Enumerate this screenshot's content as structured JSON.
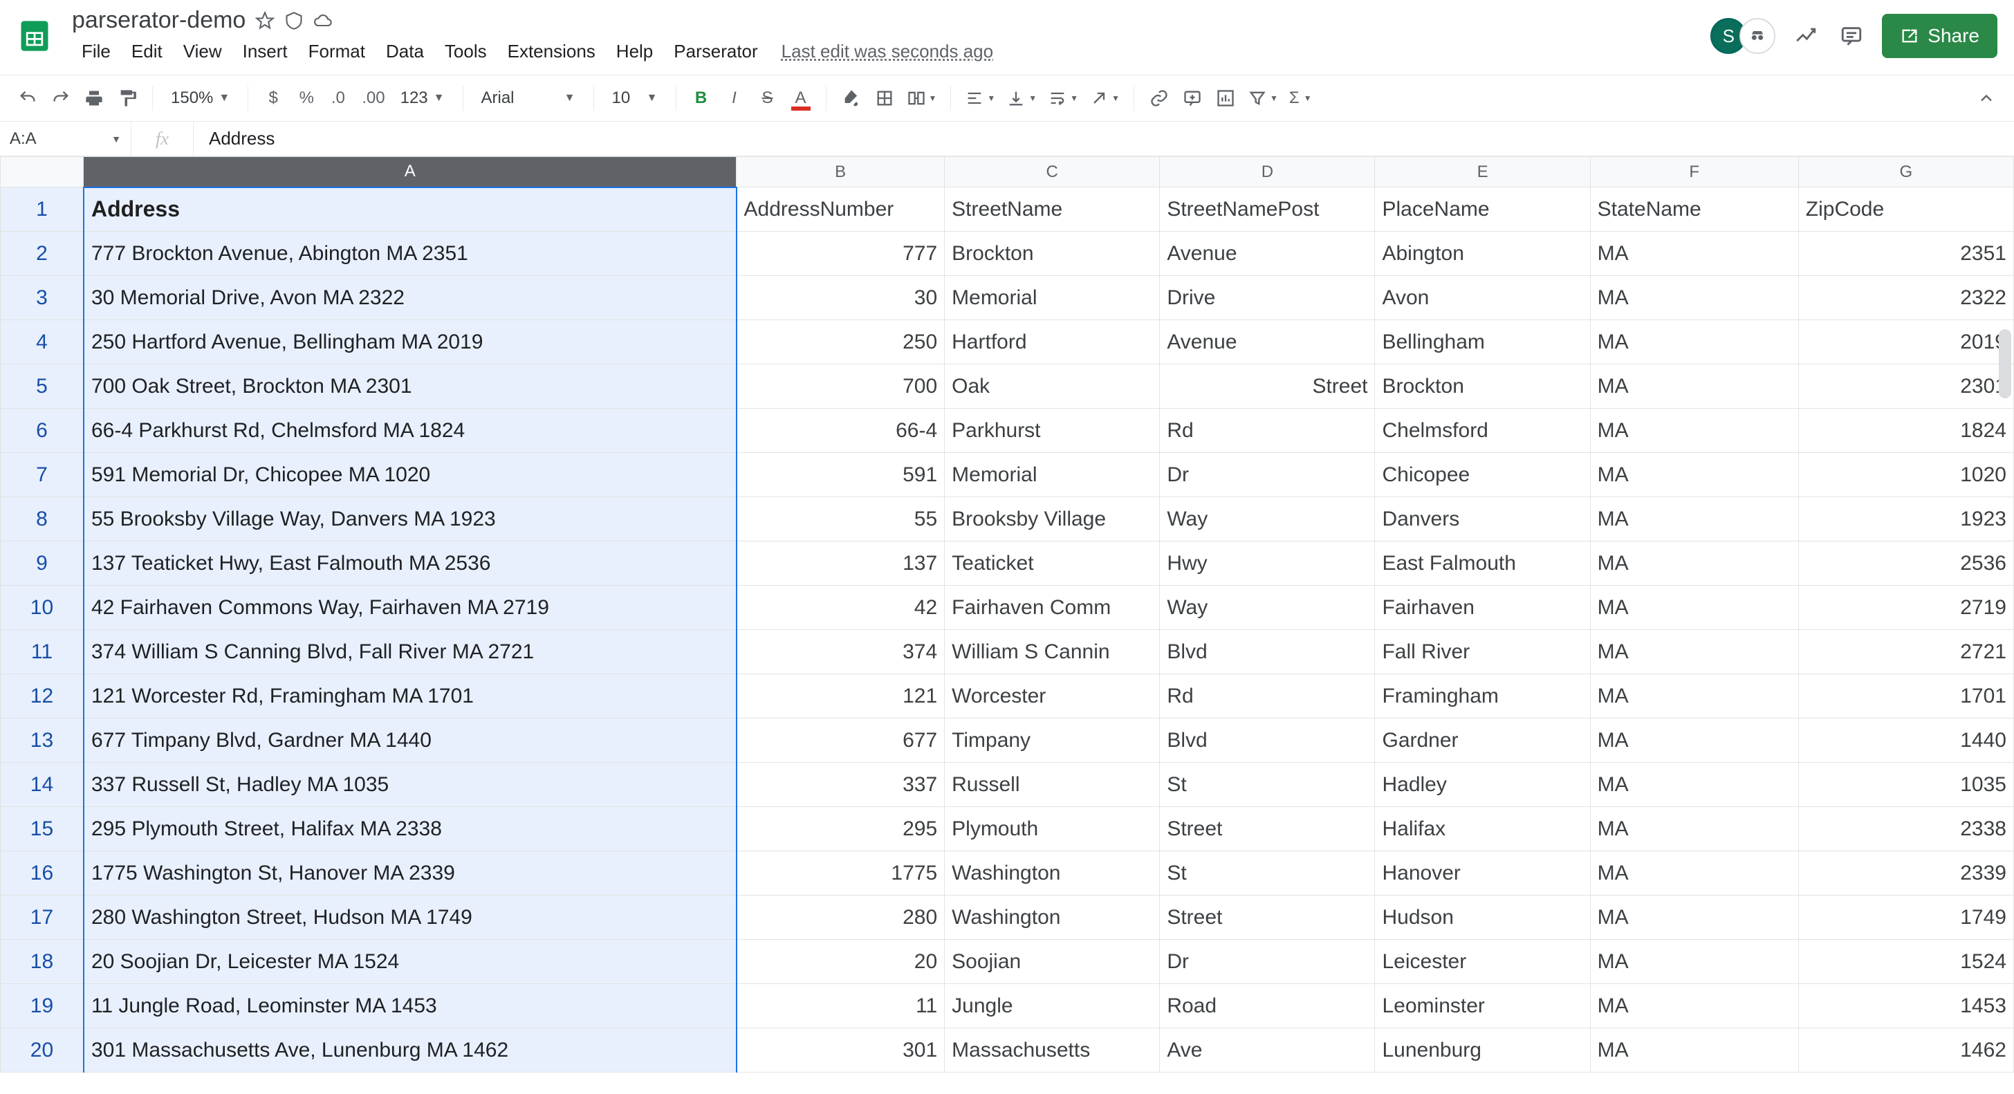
{
  "doc": {
    "title": "parserator-demo",
    "last_edit": "Last edit was seconds ago"
  },
  "menus": [
    "File",
    "Edit",
    "View",
    "Insert",
    "Format",
    "Data",
    "Tools",
    "Extensions",
    "Help",
    "Parserator"
  ],
  "share": "Share",
  "avatar_letter": "S",
  "toolbar": {
    "zoom": "150%",
    "font": "Arial",
    "size": "10",
    "fmt123": "123"
  },
  "namebox": "A:A",
  "fx_value": "Address",
  "columns": [
    "A",
    "B",
    "C",
    "D",
    "E",
    "F",
    "G"
  ],
  "col_widths": [
    "colA",
    "colB",
    "colC",
    "colD",
    "colE",
    "colF",
    "colG"
  ],
  "headers": [
    "Address",
    "AddressNumber",
    "StreetName",
    "StreetNamePost",
    "PlaceName",
    "StateName",
    "ZipCode"
  ],
  "rows": [
    {
      "n": 2,
      "a": "777 Brockton Avenue, Abington MA 2351",
      "b": "777",
      "c": "Brockton",
      "d": "Avenue",
      "e": "Abington",
      "f": "MA",
      "g": "2351"
    },
    {
      "n": 3,
      "a": "30 Memorial Drive, Avon MA 2322",
      "b": "30",
      "c": "Memorial",
      "d": "Drive",
      "e": "Avon",
      "f": "MA",
      "g": "2322"
    },
    {
      "n": 4,
      "a": "250 Hartford Avenue, Bellingham MA 2019",
      "b": "250",
      "c": "Hartford",
      "d": "Avenue",
      "e": "Bellingham",
      "f": "MA",
      "g": "2019"
    },
    {
      "n": 5,
      "a": "700 Oak Street, Brockton MA 2301",
      "b": "700",
      "c": "Oak",
      "d": "",
      "d_right": "Street",
      "e": "Brockton",
      "f": "MA",
      "g": "2301"
    },
    {
      "n": 6,
      "a": "66-4 Parkhurst Rd, Chelmsford MA 1824",
      "b": "66-4",
      "c": "Parkhurst",
      "d": "Rd",
      "e": "Chelmsford",
      "f": "MA",
      "g": "1824"
    },
    {
      "n": 7,
      "a": "591 Memorial Dr, Chicopee MA 1020",
      "b": "591",
      "c": "Memorial",
      "d": "Dr",
      "e": "Chicopee",
      "f": "MA",
      "g": "1020"
    },
    {
      "n": 8,
      "a": "55 Brooksby Village Way, Danvers MA 1923",
      "b": "55",
      "c": "Brooksby Village",
      "d": "Way",
      "e": "Danvers",
      "f": "MA",
      "g": "1923"
    },
    {
      "n": 9,
      "a": "137 Teaticket Hwy, East Falmouth MA 2536",
      "b": "137",
      "c": "Teaticket",
      "d": "Hwy",
      "e": "East Falmouth",
      "f": "MA",
      "g": "2536"
    },
    {
      "n": 10,
      "a": "42 Fairhaven Commons Way, Fairhaven MA 2719",
      "b": "42",
      "c": "Fairhaven Comm",
      "d": "Way",
      "e": "Fairhaven",
      "f": "MA",
      "g": "2719"
    },
    {
      "n": 11,
      "a": "374 William S Canning Blvd, Fall River MA 2721",
      "b": "374",
      "c": "William S Cannin",
      "d": "Blvd",
      "e": "Fall River",
      "f": "MA",
      "g": "2721"
    },
    {
      "n": 12,
      "a": "121 Worcester Rd, Framingham MA 1701",
      "b": "121",
      "c": "Worcester",
      "d": "Rd",
      "e": "Framingham",
      "f": "MA",
      "g": "1701"
    },
    {
      "n": 13,
      "a": "677 Timpany Blvd, Gardner MA 1440",
      "b": "677",
      "c": "Timpany",
      "d": "Blvd",
      "e": "Gardner",
      "f": "MA",
      "g": "1440"
    },
    {
      "n": 14,
      "a": "337 Russell St, Hadley MA 1035",
      "b": "337",
      "c": "Russell",
      "d": "St",
      "e": "Hadley",
      "f": "MA",
      "g": "1035"
    },
    {
      "n": 15,
      "a": "295 Plymouth Street, Halifax MA 2338",
      "b": "295",
      "c": "Plymouth",
      "d": "Street",
      "e": "Halifax",
      "f": "MA",
      "g": "2338"
    },
    {
      "n": 16,
      "a": "1775 Washington St, Hanover MA 2339",
      "b": "1775",
      "c": "Washington",
      "d": "St",
      "e": "Hanover",
      "f": "MA",
      "g": "2339"
    },
    {
      "n": 17,
      "a": "280 Washington Street, Hudson MA 1749",
      "b": "280",
      "c": "Washington",
      "d": "Street",
      "e": "Hudson",
      "f": "MA",
      "g": "1749"
    },
    {
      "n": 18,
      "a": "20 Soojian Dr, Leicester MA 1524",
      "b": "20",
      "c": "Soojian",
      "d": "Dr",
      "e": "Leicester",
      "f": "MA",
      "g": "1524"
    },
    {
      "n": 19,
      "a": "11 Jungle Road, Leominster MA 1453",
      "b": "11",
      "c": "Jungle",
      "d": "Road",
      "e": "Leominster",
      "f": "MA",
      "g": "1453"
    },
    {
      "n": 20,
      "a": "301 Massachusetts Ave, Lunenburg MA 1462",
      "b": "301",
      "c": "Massachusetts",
      "d": "Ave",
      "e": "Lunenburg",
      "f": "MA",
      "g": "1462"
    }
  ]
}
